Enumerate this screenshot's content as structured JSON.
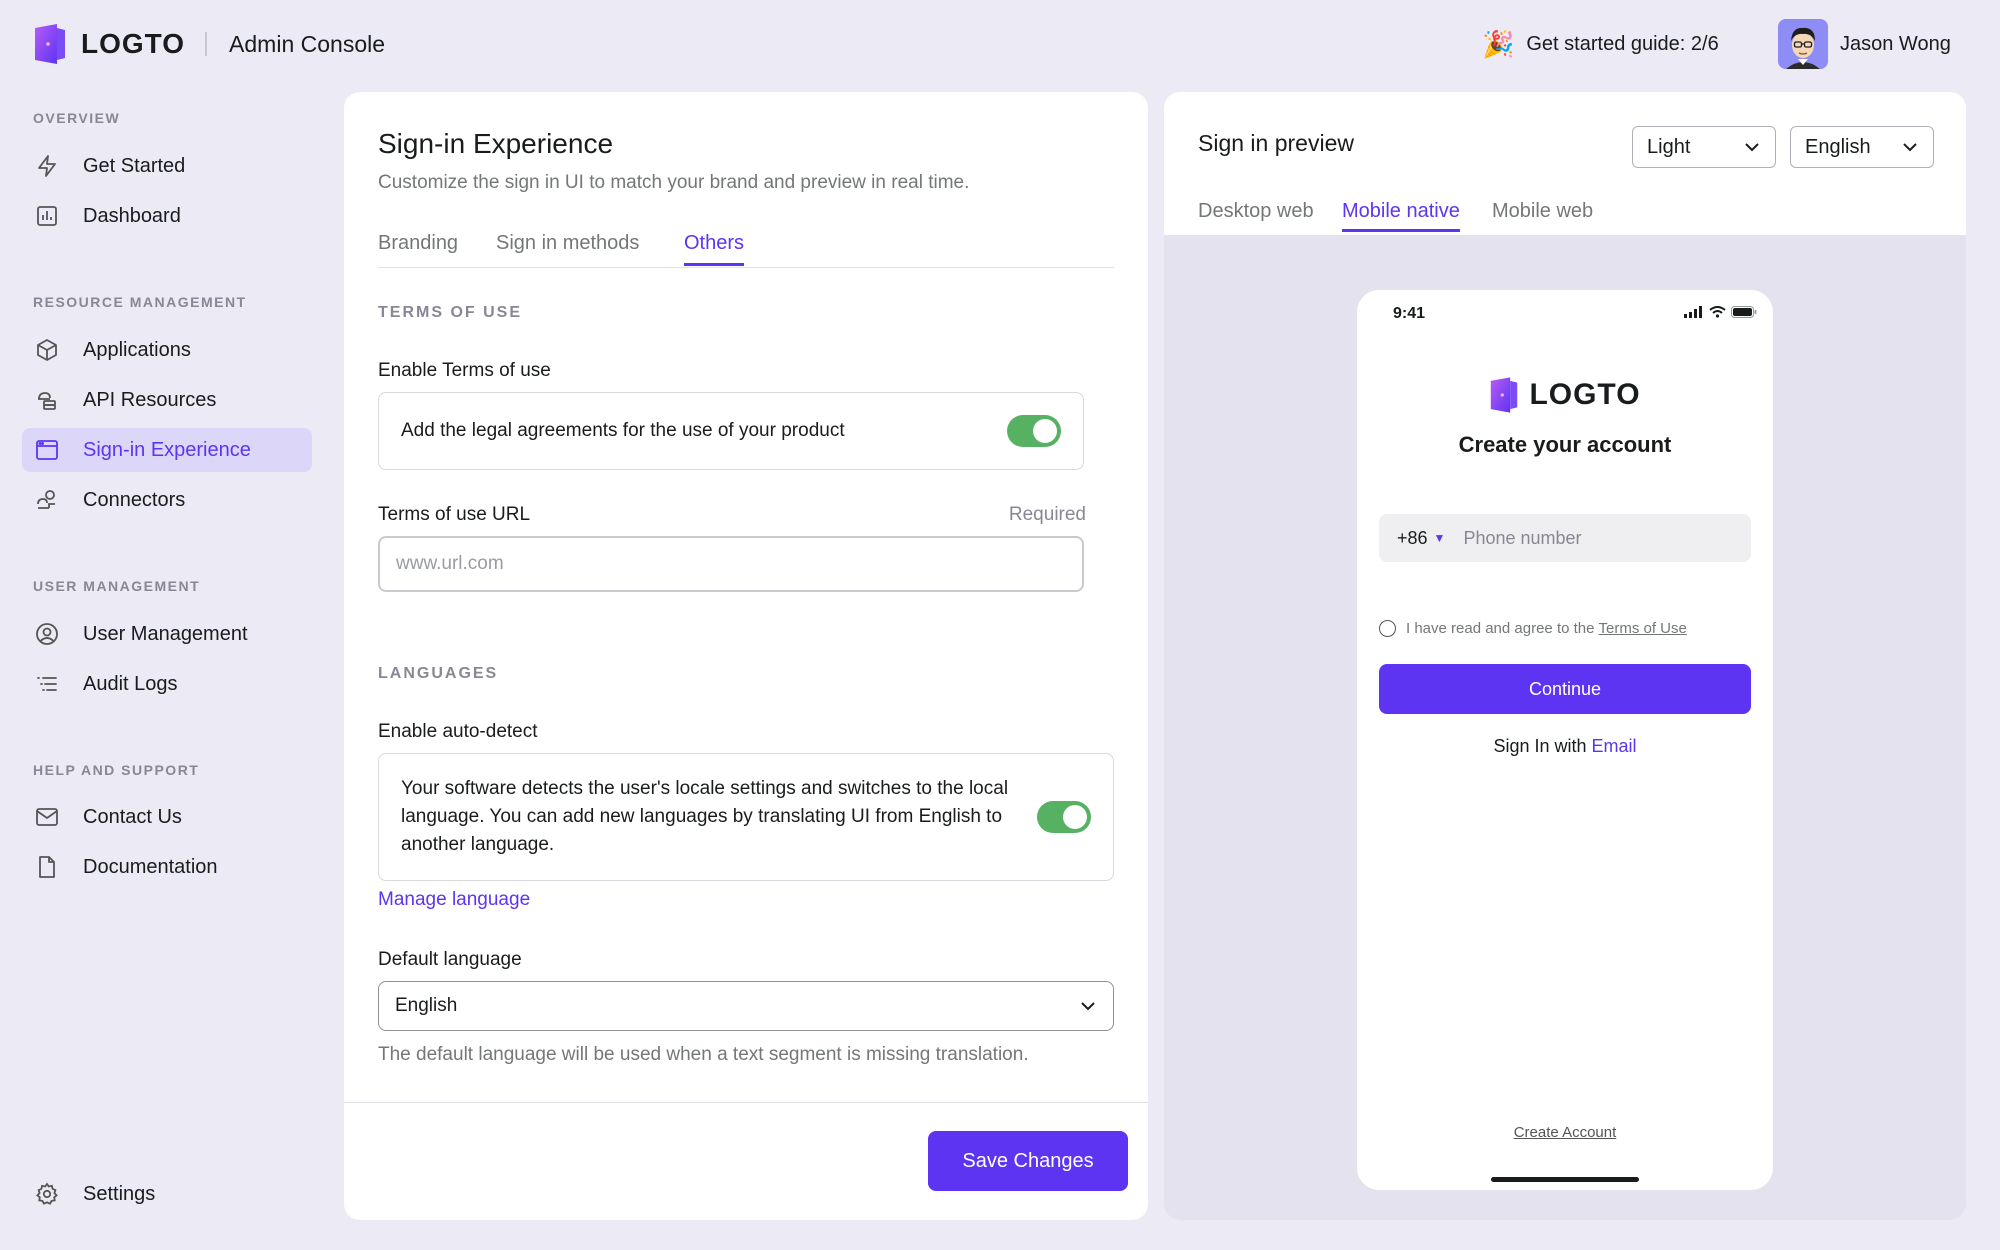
{
  "topbar": {
    "brand_word": "LOGTO",
    "app_title": "Admin Console",
    "guide_icon": "party-popper",
    "guide_text": "Get started guide: 2/6",
    "user_name": "Jason Wong"
  },
  "sidebar": {
    "groups": [
      {
        "title": "OVERVIEW",
        "items": [
          {
            "label": "Get Started",
            "icon": "lightning-icon"
          },
          {
            "label": "Dashboard",
            "icon": "bar-chart-icon"
          }
        ]
      },
      {
        "title": "RESOURCE MANAGEMENT",
        "items": [
          {
            "label": "Applications",
            "icon": "cube-icon"
          },
          {
            "label": "API Resources",
            "icon": "api-resources-icon"
          },
          {
            "label": "Sign-in Experience",
            "icon": "browser-window-icon",
            "active": true
          },
          {
            "label": "Connectors",
            "icon": "connector-icon"
          }
        ]
      },
      {
        "title": "USER MANAGEMENT",
        "items": [
          {
            "label": "User Management",
            "icon": "user-circle-icon"
          },
          {
            "label": "Audit Logs",
            "icon": "list-icon"
          }
        ]
      },
      {
        "title": "HELP AND SUPPORT",
        "items": [
          {
            "label": "Contact Us",
            "icon": "mail-icon"
          },
          {
            "label": "Documentation",
            "icon": "document-icon"
          }
        ]
      }
    ],
    "settings_label": "Settings"
  },
  "main": {
    "title": "Sign-in Experience",
    "subtitle": "Customize the sign in UI to match your brand and preview in real time.",
    "tabs": [
      {
        "label": "Branding"
      },
      {
        "label": "Sign in methods"
      },
      {
        "label": "Others",
        "active": true
      }
    ],
    "terms": {
      "section_title": "TERMS OF USE",
      "enable_label": "Enable Terms of use",
      "enable_description": "Add the legal agreements for the use of your product",
      "enabled": true,
      "url_label": "Terms of use URL",
      "url_required": "Required",
      "url_value": "",
      "url_placeholder": "www.url.com"
    },
    "languages": {
      "section_title": "LANGUAGES",
      "auto_detect_label": "Enable auto-detect",
      "auto_detect_description": "Your software detects the user's locale settings and switches to the local language. You can add new languages by translating UI from English to another language.",
      "auto_detect_enabled": true,
      "manage_link": "Manage language",
      "default_label": "Default language",
      "default_value": "English",
      "default_helper": "The default language will be used when a text segment is missing translation."
    },
    "save_label": "Save Changes"
  },
  "preview": {
    "title": "Sign in preview",
    "theme_value": "Light",
    "language_value": "English",
    "tabs": [
      {
        "label": "Desktop web"
      },
      {
        "label": "Mobile native",
        "active": true
      },
      {
        "label": "Mobile web"
      }
    ],
    "phone": {
      "time": "9:41",
      "brand_word": "LOGTO",
      "heading": "Create your account",
      "country_code": "+86",
      "phone_placeholder": "Phone number",
      "agree_text": "I have read and agree to the",
      "terms_link": "Terms of Use",
      "continue_label": "Continue",
      "sign_in_with": "Sign In with",
      "sign_in_method": "Email",
      "create_account": "Create Account"
    }
  },
  "colors": {
    "accent": "#5D34F2",
    "background": "#ECEAF5",
    "active_nav_bg": "#DCD7F8",
    "toggle_on": "#57B163"
  }
}
